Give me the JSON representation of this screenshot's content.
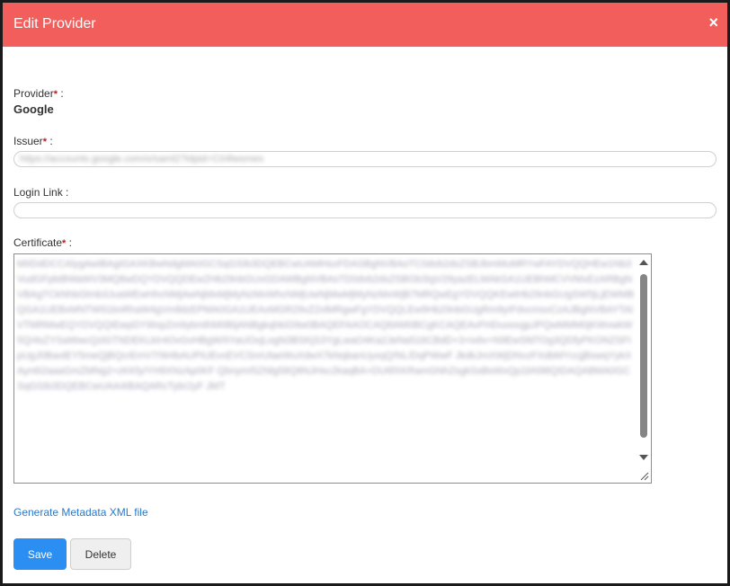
{
  "header": {
    "title": "Edit Provider",
    "close_icon": "×"
  },
  "provider": {
    "label": "Provider",
    "required_mark": "*",
    "colon": ":",
    "value": "Google"
  },
  "issuer": {
    "label": "Issuer",
    "required_mark": "*",
    "colon": ":",
    "value": "https://accounts.google.com/o/saml2?idpid=C04lwsmes"
  },
  "login_link": {
    "label": "Login Link :",
    "value": ""
  },
  "certificate": {
    "label": "Certificate",
    "required_mark": "*",
    "colon": ":",
    "value": "MIIDdDCCAlygAwIBAgIGAXKBwNdgMA0GCSqGSIb3DQEBCwUAMHsxFDASBgNVBAoTC0dvb2dsZSBJbmMuMRYwFAYDVQQHEw1Nb3VudGFpbiBWaWV3MQ8wDQYDVQQDEwZHb29nbGUxGDAWBgNVBAsTD0dvb2dsZSBGb3IgV29yazELMAkGA1UEBhMCVVMxEzARBgNVBAgTCkNhbGlmb3JuaWEwHhcNMjAwNjMxMjMyNzMxWhcNMjUwNjMwMjMyNzMxWjB7MRQwEgYDVQQKEwtHb29nbGUgSW5jLjEWMBQGA1UEBxMNTW91bnRhaW4gVmlldzEPMA0GA1UEAxMGR29vZ2xlMRgwFgYDVQQLEw9Hb29nbGUgRm9yIFdvcmsxCzAJBgNVBAYTAlVTMRMwEQYDVQQIEwpDYWxpZm9ybmlhMIIBIjANBgkqhkiG9w0BAQEFAAOCAQ8AMIIBCgKCAQEAvFHDuooxgpJPQwMMM0jKWvwkW5Q/4sZYSaWwcQzlGTNDEKLkIr4OvGvHBgW/IiYaUOxjLogN3BSKjS3YgLwaO4Ka2JeNa516CBdD+3+ix6v+N9EwSfdTOg3QDfyPKONZSFIpUgJ0BaxtEY5meQjBQcrEmV7/W4bAUPiUEvxEVCSnrUlaeWuXdwX7kNqbanUyxqQ/NL/DqPWwF JkdkJmXWjDNvzFXdbMYccjjBswqYykXAyn6i2aaaGmZMNg2+zKKfy/YH9XNzAp0KF QbnymI5ZNlg58Q8NJHsc2kaqBA+DU6fXKRamGNhZsgkSsBsWxQp1bN98QIDAQABMA0GCSqGSIb3DQEBCwUAA4IBAQARcTybr2yF JMT",
    "scroll_up_icon": "scroll-up",
    "scroll_down_icon": "scroll-down",
    "resize_icon": "resize-handle"
  },
  "links": {
    "generate_metadata": "Generate Metadata XML file"
  },
  "buttons": {
    "save": "Save",
    "delete": "Delete"
  },
  "colors": {
    "header_bg": "#f25e5b",
    "primary": "#2b8ef3",
    "required": "#b22222",
    "link": "#2a78c8"
  }
}
